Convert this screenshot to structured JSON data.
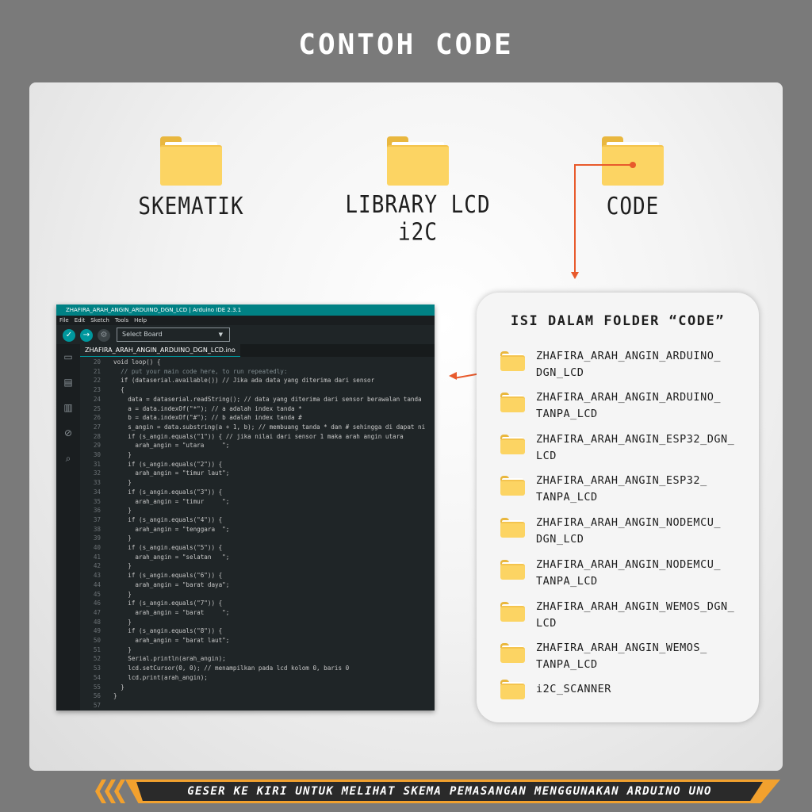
{
  "page_title": "CONTOH CODE",
  "top_folders": [
    {
      "label": "SKEMATIK"
    },
    {
      "label": "LIBRARY LCD i2C"
    },
    {
      "label": "CODE"
    }
  ],
  "ide": {
    "window_title": "ZHAFIRA_ARAH_ANGIN_ARDUINO_DGN_LCD | Arduino IDE 2.3.1",
    "menu": [
      "File",
      "Edit",
      "Sketch",
      "Tools",
      "Help"
    ],
    "board_select": "Select Board",
    "tab_name": "ZHAFIRA_ARAH_ANGIN_ARDUINO_DGN_LCD.ino",
    "code_lines": [
      {
        "n": "20",
        "text": "void loop() {"
      },
      {
        "n": "21",
        "text": "  // put your main code here, to run repeatedly:"
      },
      {
        "n": "22",
        "text": "  if (dataserial.available()) // Jika ada data yang diterima dari sensor"
      },
      {
        "n": "23",
        "text": "  {"
      },
      {
        "n": "24",
        "text": "    data = dataserial.readString(); // data yang diterima dari sensor berawalan tanda"
      },
      {
        "n": "25",
        "text": "    a = data.indexOf(\"*\"); // a adalah index tanda *"
      },
      {
        "n": "26",
        "text": "    b = data.indexOf(\"#\"); // b adalah index tanda #"
      },
      {
        "n": "27",
        "text": "    s_angin = data.substring(a + 1, b); // membuang tanda * dan # sehingga di dapat ni"
      },
      {
        "n": "28",
        "text": "    if (s_angin.equals(\"1\")) { // jika nilai dari sensor 1 maka arah angin utara"
      },
      {
        "n": "29",
        "text": "      arah_angin = \"utara     \";"
      },
      {
        "n": "30",
        "text": "    }"
      },
      {
        "n": "31",
        "text": "    if (s_angin.equals(\"2\")) {"
      },
      {
        "n": "32",
        "text": "      arah_angin = \"timur laut\";"
      },
      {
        "n": "33",
        "text": "    }"
      },
      {
        "n": "34",
        "text": "    if (s_angin.equals(\"3\")) {"
      },
      {
        "n": "35",
        "text": "      arah_angin = \"timur     \";"
      },
      {
        "n": "36",
        "text": "    }"
      },
      {
        "n": "37",
        "text": "    if (s_angin.equals(\"4\")) {"
      },
      {
        "n": "38",
        "text": "      arah_angin = \"tenggara  \";"
      },
      {
        "n": "39",
        "text": "    }"
      },
      {
        "n": "40",
        "text": "    if (s_angin.equals(\"5\")) {"
      },
      {
        "n": "41",
        "text": "      arah_angin = \"selatan   \";"
      },
      {
        "n": "42",
        "text": "    }"
      },
      {
        "n": "43",
        "text": "    if (s_angin.equals(\"6\")) {"
      },
      {
        "n": "44",
        "text": "      arah_angin = \"barat daya\";"
      },
      {
        "n": "45",
        "text": "    }"
      },
      {
        "n": "46",
        "text": "    if (s_angin.equals(\"7\")) {"
      },
      {
        "n": "47",
        "text": "      arah_angin = \"barat     \";"
      },
      {
        "n": "48",
        "text": "    }"
      },
      {
        "n": "49",
        "text": "    if (s_angin.equals(\"8\")) {"
      },
      {
        "n": "50",
        "text": "      arah_angin = \"barat laut\";"
      },
      {
        "n": "51",
        "text": "    }"
      },
      {
        "n": "52",
        "text": "    Serial.println(arah_angin);"
      },
      {
        "n": "53",
        "text": "    lcd.setCursor(0, 0); // menampilkan pada lcd kolom 0, baris 0"
      },
      {
        "n": "54",
        "text": "    lcd.print(arah_angin);"
      },
      {
        "n": "55",
        "text": "  }"
      },
      {
        "n": "56",
        "text": "}"
      },
      {
        "n": "57",
        "text": ""
      }
    ]
  },
  "folder_panel": {
    "title": "ISI DALAM FOLDER “CODE”",
    "items": [
      {
        "name": "ZHAFIRA_ARAH_ANGIN_ARDUINO_ DGN_LCD"
      },
      {
        "name": "ZHAFIRA_ARAH_ANGIN_ARDUINO_ TANPA_LCD"
      },
      {
        "name": "ZHAFIRA_ARAH_ANGIN_ESP32_DGN_ LCD"
      },
      {
        "name": "ZHAFIRA_ARAH_ANGIN_ESP32_ TANPA_LCD"
      },
      {
        "name": "ZHAFIRA_ARAH_ANGIN_NODEMCU_ DGN_LCD"
      },
      {
        "name": "ZHAFIRA_ARAH_ANGIN_NODEMCU_ TANPA_LCD"
      },
      {
        "name": "ZHAFIRA_ARAH_ANGIN_WEMOS_DGN_ LCD"
      },
      {
        "name": "ZHAFIRA_ARAH_ANGIN_WEMOS_ TANPA_LCD"
      },
      {
        "name": "i2C_SCANNER"
      }
    ]
  },
  "banner_text": "GESER KE KIRI UNTUK MELIHAT SKEMA PEMASANGAN MENGGUNAKAN ARDUINO UNO",
  "colors": {
    "accent": "#e85a2c",
    "banner": "#f2a12e",
    "folder": "#fcd463",
    "ide_teal": "#008184"
  },
  "icons": [
    "folder-icon",
    "verify-icon",
    "upload-icon",
    "debug-icon",
    "sketchbook-icon",
    "boards-icon",
    "library-icon",
    "debug-side-icon",
    "search-icon"
  ]
}
